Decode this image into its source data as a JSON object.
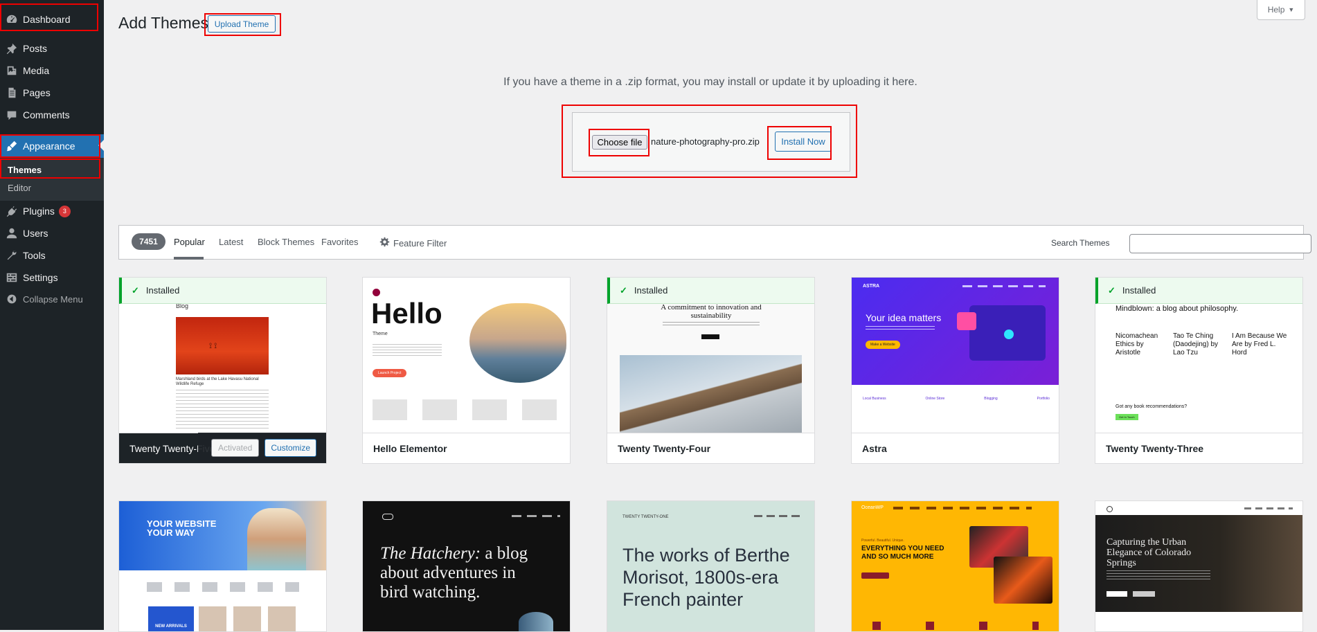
{
  "sidebar": {
    "items": [
      {
        "label": "Dashboard",
        "icon": "dashboard-icon"
      },
      {
        "label": "Posts",
        "icon": "pin-icon"
      },
      {
        "label": "Media",
        "icon": "media-icon"
      },
      {
        "label": "Pages",
        "icon": "pages-icon"
      },
      {
        "label": "Comments",
        "icon": "comment-icon"
      },
      {
        "label": "Appearance",
        "icon": "brush-icon"
      },
      {
        "label": "Plugins",
        "icon": "plugin-icon",
        "badge": "3"
      },
      {
        "label": "Users",
        "icon": "user-icon"
      },
      {
        "label": "Tools",
        "icon": "wrench-icon"
      },
      {
        "label": "Settings",
        "icon": "settings-icon"
      },
      {
        "label": "Collapse Menu",
        "icon": "collapse-icon"
      }
    ],
    "submenu": [
      {
        "label": "Themes"
      },
      {
        "label": "Editor"
      }
    ]
  },
  "header": {
    "title": "Add Themes",
    "upload_button": "Upload Theme",
    "help": "Help"
  },
  "upload": {
    "description": "If you have a theme in a .zip format, you may install or update it by uploading it here.",
    "choose_file": "Choose file",
    "file_name": "nature-photography-pro.zip",
    "install_button": "Install Now"
  },
  "filter": {
    "count": "7451",
    "tabs": [
      "Popular",
      "Latest",
      "Block Themes",
      "Favorites"
    ],
    "feature_filter": "Feature Filter",
    "search_label": "Search Themes"
  },
  "themes": [
    {
      "name": "Twenty Twenty-Five",
      "installed": "Installed",
      "activated": "Activated",
      "customize": "Customize",
      "preview": {
        "heading": "Blog",
        "caption": "Marshland birds at the Lake Havasu National Wildlife Refuge"
      }
    },
    {
      "name": "Hello Elementor",
      "preview": {
        "big": "Hello",
        "sub": "Theme",
        "button": "Launch Project"
      }
    },
    {
      "name": "Twenty Twenty-Four",
      "installed": "Installed",
      "preview": {
        "heading": "A commitment to innovation and sustainability"
      }
    },
    {
      "name": "Astra",
      "preview": {
        "logo": "ASTRA",
        "heading": "Your idea matters",
        "button": "Make a Website",
        "features": [
          "Local Business",
          "Online Store",
          "Blogging",
          "Portfolio"
        ]
      }
    },
    {
      "name": "Twenty Twenty-Three",
      "installed": "Installed",
      "preview": {
        "heading": "Mindblown: a blog about philosophy.",
        "posts": [
          "Nicomachean Ethics by Aristotle",
          "Tao Te Ching (Daodejing) by Lao Tzu",
          "I Am Because We Are by Fred L. Hord"
        ],
        "question": "Got any book recommendations?",
        "button": "Get In Touch"
      }
    }
  ],
  "themes_row2": [
    {
      "preview": {
        "heading": "YOUR WEBSITE YOUR WAY",
        "label": "NEW ARRIVALS"
      }
    },
    {
      "preview": {
        "heading_italic": "The Hatchery:",
        "heading": "a blog about adventures in bird watching."
      }
    },
    {
      "preview": {
        "logo": "TWENTY TWENTY-ONE",
        "heading": "The works of Berthe Morisot, 1800s-era French painter"
      }
    },
    {
      "preview": {
        "logo": "OceanWP",
        "tagline": "Powerful. Beautiful. Unique.",
        "heading": "EVERYTHING YOU NEED AND SO MUCH MORE"
      }
    },
    {
      "preview": {
        "heading": "Capturing the Urban Elegance of Colorado Springs"
      }
    }
  ],
  "colors": {
    "accent": "#2271b1",
    "sidebar": "#1d2327",
    "installed": "#00a32a",
    "highlight": "#ee0000"
  }
}
